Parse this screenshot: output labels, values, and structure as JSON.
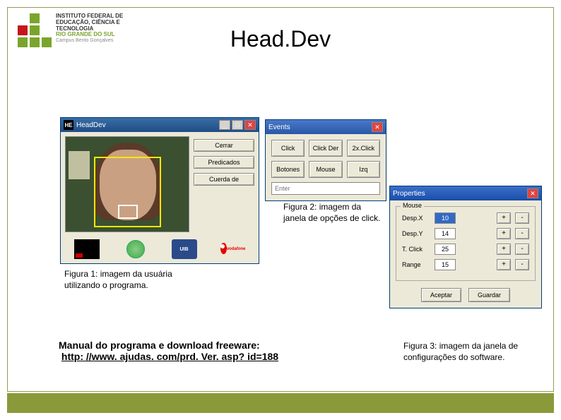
{
  "logo": {
    "line1": "INSTITUTO FEDERAL DE",
    "line2": "EDUCAÇÃO, CIÊNCIA E TECNOLOGIA",
    "line3": "RIO GRANDE DO SUL",
    "line4": "Campus Bento Gonçalves"
  },
  "title": "Head.Dev",
  "captions": {
    "fig1": "Figura 1: imagem da usuária utilizando o programa.",
    "fig2": "Figura 2: imagem da janela de opções de click.",
    "fig3": "Figura 3: imagem da janela de configurações do software."
  },
  "manual": {
    "label": "Manual do programa e download freeware:",
    "url": "http: //www. ajudas. com/prd. Ver. asp? id=188"
  },
  "win1": {
    "title": "HeadDev",
    "btns": {
      "cerrar": "Cerrar",
      "predicados": "Predicados",
      "cuerda": "Cuerda de"
    },
    "logos": {
      "uib": "UIB",
      "voda": "vodafone"
    }
  },
  "win2": {
    "title": "Events",
    "row1": {
      "a": "Click",
      "b": "Click Der",
      "c": "2x.Click"
    },
    "row2": {
      "a": "Botones",
      "b": "Mouse",
      "c": "Izq"
    },
    "placeholder": "Enter"
  },
  "win3": {
    "title": "Properties",
    "group": "Mouse",
    "rows": [
      {
        "label": "Desp.X",
        "value": "10",
        "sel": true
      },
      {
        "label": "Desp.Y",
        "value": "14",
        "sel": false
      },
      {
        "label": "T. Click",
        "value": "25",
        "sel": false
      },
      {
        "label": "Range",
        "value": "15",
        "sel": false
      }
    ],
    "plus": "+",
    "minus": "-",
    "accept": "Aceptar",
    "save": "Guardar"
  }
}
